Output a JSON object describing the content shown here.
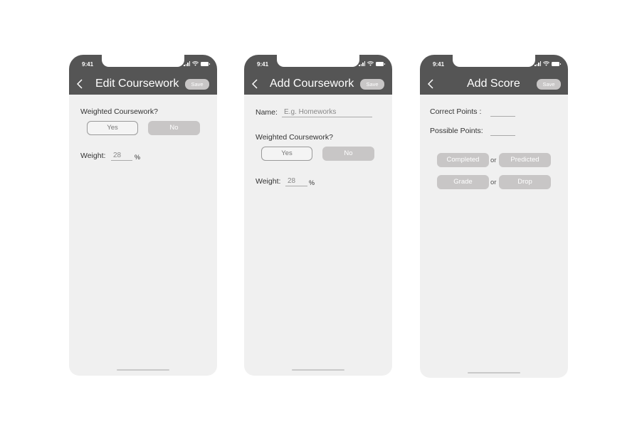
{
  "status_time": "9:41",
  "screens": {
    "edit": {
      "title": "Edit Coursework",
      "save_label": "Save",
      "weighted_label": "Weighted Coursework?",
      "yes_label": "Yes",
      "no_label": "No",
      "weight_label": "Weight:",
      "weight_value": "28",
      "weight_unit": "%"
    },
    "add": {
      "title": "Add Coursework",
      "save_label": "Save",
      "name_label": "Name:",
      "name_placeholder": "E.g. Homeworks",
      "weighted_label": "Weighted Coursework?",
      "yes_label": "Yes",
      "no_label": "No",
      "weight_label": "Weight:",
      "weight_value": "28",
      "weight_unit": "%"
    },
    "score": {
      "title": "Add Score",
      "save_label": "Save",
      "correct_label": "Correct Points  :",
      "possible_label": "Possible Points:",
      "completed_label": "Completed",
      "or_label": "or",
      "predicted_label": "Predicted",
      "grade_label": "Grade",
      "drop_label": "Drop"
    }
  },
  "colors": {
    "header": "#555555",
    "screen_bg": "#f0f0f0",
    "pill": "#c8c6c6"
  }
}
